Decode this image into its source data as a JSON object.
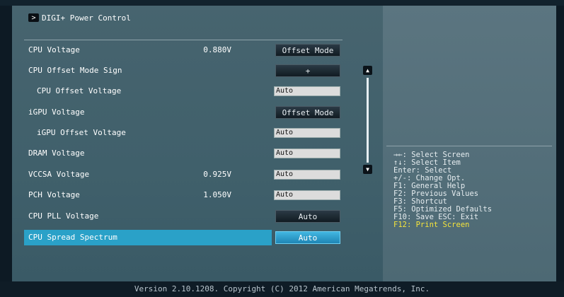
{
  "breadcrumb": {
    "arrow": ">",
    "label": "DIGI+ Power Control"
  },
  "settings": [
    {
      "label": "CPU Voltage",
      "value": "0.880V",
      "control": "Offset Mode"
    },
    {
      "label": "CPU Offset Mode Sign",
      "value": "",
      "control": "+"
    },
    {
      "label": "CPU Offset Voltage",
      "value": "",
      "control": "Auto"
    },
    {
      "label": "iGPU Voltage",
      "value": "",
      "control": "Offset Mode"
    },
    {
      "label": "iGPU Offset Voltage",
      "value": "",
      "control": "Auto"
    },
    {
      "label": "DRAM Voltage",
      "value": "",
      "control": "Auto"
    },
    {
      "label": "VCCSA Voltage",
      "value": "0.925V",
      "control": "Auto"
    },
    {
      "label": "PCH Voltage",
      "value": "1.050V",
      "control": "Auto"
    },
    {
      "label": "CPU PLL Voltage",
      "value": "",
      "control": "Auto"
    },
    {
      "label": "CPU Spread Spectrum",
      "value": "",
      "control": "Auto"
    }
  ],
  "scrollbar": {
    "up": "▲",
    "down": "▼"
  },
  "help": [
    "→←: Select Screen",
    "↑↓: Select Item",
    "Enter: Select",
    "+/-: Change Opt.",
    "F1: General Help",
    "F2: Previous Values",
    "F3: Shortcut",
    "F5: Optimized Defaults",
    "F10: Save  ESC: Exit",
    "F12: Print Screen"
  ],
  "footer": "Version 2.10.1208. Copyright (C) 2012 American Megatrends, Inc.",
  "colors": {
    "highlight": "#2aa1c8",
    "help_accent": "#f5e43b",
    "panel": "#47646f"
  }
}
